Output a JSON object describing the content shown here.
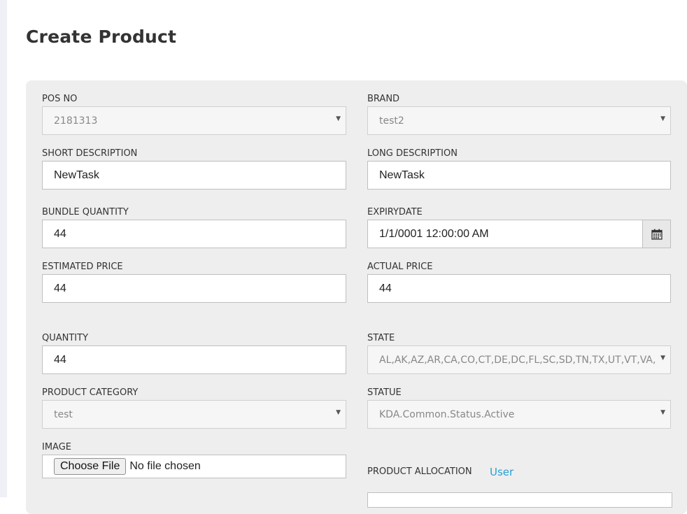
{
  "page": {
    "title": "Create Product"
  },
  "form": {
    "pos_no": {
      "label": "POS NO",
      "value": "2181313"
    },
    "brand": {
      "label": "BRAND",
      "value": "test2"
    },
    "short_description": {
      "label": "SHORT DESCRIPTION",
      "value": "NewTask"
    },
    "long_description": {
      "label": "LONG DESCRIPTION",
      "value": "NewTask"
    },
    "bundle_quantity": {
      "label": "BUNDLE QUANTITY",
      "value": "44"
    },
    "expiry_date": {
      "label": "EXPIRYDATE",
      "value": "1/1/0001 12:00:00 AM",
      "icon": "calendar-icon"
    },
    "estimated_price": {
      "label": "ESTIMATED PRICE",
      "value": "44"
    },
    "actual_price": {
      "label": "ACTUAL PRICE",
      "value": "44"
    },
    "quantity": {
      "label": "QUANTITY",
      "value": "44"
    },
    "state": {
      "label": "STATE",
      "value": "AL,AK,AZ,AR,CA,CO,CT,DE,DC,FL,SC,SD,TN,TX,UT,VT,VA,"
    },
    "product_category": {
      "label": "PRODUCT CATEGORY",
      "value": "test"
    },
    "statue": {
      "label": "STATUE",
      "value": "KDA.Common.Status.Active"
    },
    "image": {
      "label": "IMAGE",
      "button_label": "Choose File",
      "status": "No file chosen"
    },
    "product_allocation": {
      "label": "PRODUCT ALLOCATION",
      "link": "User"
    }
  },
  "colors": {
    "panel": "#eeeeee",
    "link": "#2a9fd6",
    "title": "#333333"
  }
}
